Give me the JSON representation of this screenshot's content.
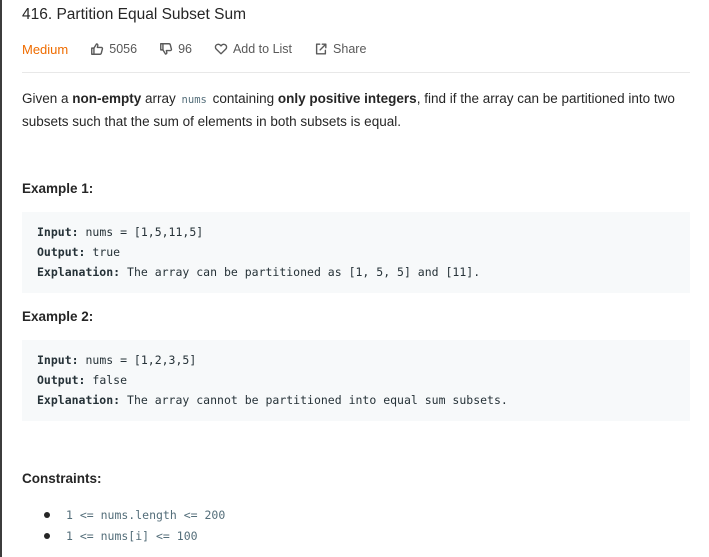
{
  "problem": {
    "title": "416. Partition Equal Subset Sum",
    "difficulty": "Medium",
    "likes": "5056",
    "dislikes": "96",
    "add_to_list": "Add to List",
    "share": "Share"
  },
  "description": {
    "p1_a": "Given a ",
    "p1_b": "non-empty",
    "p1_c": " array ",
    "p1_code": "nums",
    "p1_d": " containing ",
    "p1_e": "only positive integers",
    "p1_f": ", find if the array can be partitioned into two subsets such that the sum of elements in both subsets is equal."
  },
  "examples": [
    {
      "heading": "Example 1:",
      "input_label": "Input:",
      "input_value": " nums = [1,5,11,5]",
      "output_label": "Output:",
      "output_value": " true",
      "explanation_label": "Explanation:",
      "explanation_value": " The array can be partitioned as [1, 5, 5] and [11]."
    },
    {
      "heading": "Example 2:",
      "input_label": "Input:",
      "input_value": " nums = [1,2,3,5]",
      "output_label": "Output:",
      "output_value": " false",
      "explanation_label": "Explanation:",
      "explanation_value": " The array cannot be partitioned into equal sum subsets."
    }
  ],
  "constraints": {
    "heading": "Constraints:",
    "items": [
      "1 <= nums.length <= 200",
      "1 <= nums[i] <= 100"
    ]
  },
  "colors": {
    "difficulty_medium": "#ef6c00",
    "code_bg": "#f7f9fa"
  }
}
